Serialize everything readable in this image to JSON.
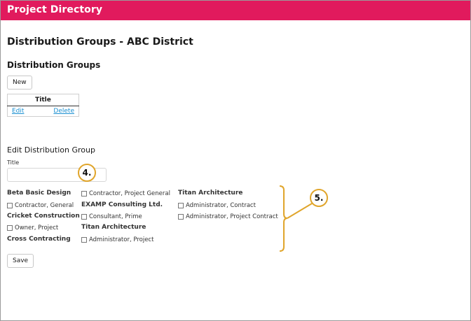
{
  "header": {
    "app_title": "Project Directory",
    "bar_color": "#e11a5d"
  },
  "page": {
    "title": "Distribution Groups - ABC District"
  },
  "groups_section": {
    "title": "Distribution Groups",
    "new_label": "New",
    "table": {
      "column": "Title",
      "rows": [
        {
          "edit": "Edit",
          "delete": "Delete"
        }
      ]
    }
  },
  "edit_section": {
    "title": "Edit Distribution Group",
    "title_label": "Title",
    "title_value": "",
    "save_label": "Save"
  },
  "companies": {
    "col1": [
      {
        "name": "Beta Basic Design",
        "contacts": [
          "Contractor, General"
        ]
      },
      {
        "name": "Cricket Construction",
        "contacts": [
          "Owner, Project"
        ]
      },
      {
        "name": "Cross Contracting",
        "contacts": []
      }
    ],
    "col2": [
      {
        "name": "",
        "contacts": [
          "Contractor, Project General"
        ]
      },
      {
        "name": "EXAMP Consulting Ltd.",
        "contacts": [
          "Consultant, Prime"
        ]
      },
      {
        "name": "Titan Architecture",
        "contacts": [
          "Administrator, Project"
        ]
      }
    ],
    "col3": [
      {
        "name": "Titan Architecture",
        "contacts": [
          "Administrator, Contract",
          "Administrator, Project Contract"
        ]
      }
    ]
  },
  "callouts": {
    "step4": "4.",
    "step5": "5.",
    "color": "#e0a52b"
  }
}
